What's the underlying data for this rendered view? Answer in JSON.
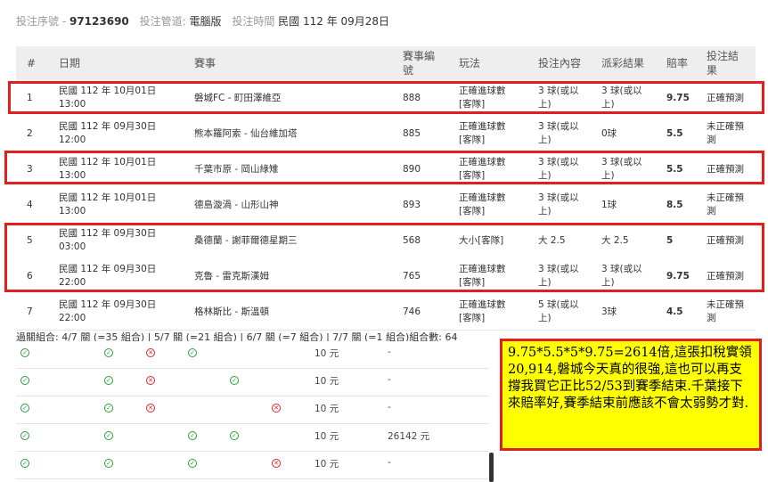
{
  "header": {
    "serial_label": "投注序號 -",
    "serial_value": "97123690",
    "channel_label": "投注管道:",
    "channel_value": "電腦版",
    "time_label": "投注時間",
    "time_value": "民國 112 年 09月28日"
  },
  "table": {
    "columns": {
      "num": "#",
      "date": "日期",
      "match": "賽事",
      "code": "賽事編號",
      "play": "玩法",
      "bet": "投注內容",
      "result": "派彩結果",
      "odds": "賠率",
      "outcome": "投注結果"
    },
    "rows": [
      {
        "num": "1",
        "date": "民國 112 年 10月01日 13:00",
        "match": "磐城FC - 町田澤維亞",
        "code": "888",
        "play": "正確進球數 [客隊]",
        "bet": "3 球(或以上)",
        "result": "3 球(或以上)",
        "odds": "9.75",
        "outcome": "正確預測"
      },
      {
        "num": "2",
        "date": "民國 112 年 09月30日 12:00",
        "match": "熊本羅阿索 - 仙台維加塔",
        "code": "885",
        "play": "正確進球數 [客隊]",
        "bet": "3 球(或以上)",
        "result": "0球",
        "odds": "5.5",
        "outcome": "未正確預測"
      },
      {
        "num": "3",
        "date": "民國 112 年 10月01日 13:00",
        "match": "千葉市原 - 岡山綠雉",
        "code": "890",
        "play": "正確進球數 [客隊]",
        "bet": "3 球(或以上)",
        "result": "3 球(或以上)",
        "odds": "5.5",
        "outcome": "正確預測"
      },
      {
        "num": "4",
        "date": "民國 112 年 10月01日 13:00",
        "match": "德島漩渦 - 山形山神",
        "code": "893",
        "play": "正確進球數 [客隊]",
        "bet": "3 球(或以上)",
        "result": "1球",
        "odds": "8.5",
        "outcome": "未正確預測"
      },
      {
        "num": "5",
        "date": "民國 112 年 09月30日 03:00",
        "match": "桑德蘭 - 謝菲爾德星期三",
        "code": "568",
        "play": "大小[客隊]",
        "bet": "大 2.5",
        "result": "大 2.5",
        "odds": "5",
        "outcome": "正確預測"
      },
      {
        "num": "6",
        "date": "民國 112 年 09月30日 22:00",
        "match": "克魯 - 雷克斯漢姆",
        "code": "765",
        "play": "正確進球數 [客隊]",
        "bet": "3 球(或以上)",
        "result": "3 球(或以上)",
        "odds": "9.75",
        "outcome": "正確預測"
      },
      {
        "num": "7",
        "date": "民國 112 年 09月30日 22:00",
        "match": "格林斯比 - 斯溫頓",
        "code": "746",
        "play": "正確進球數 [客隊]",
        "bet": "5 球(或以上)",
        "result": "3球",
        "odds": "4.5",
        "outcome": "未正確預測"
      }
    ]
  },
  "parlay_text": "過關組合: 4/7 關 (=35 組合) | 5/7 關 (=21 組合) | 6/7 關 (=7 組合) | 7/7 關 (=1 組合)組合數: 64",
  "combos": [
    {
      "amount": "10 元",
      "win": "-"
    },
    {
      "amount": "10 元",
      "win": "-"
    },
    {
      "amount": "10 元",
      "win": "-"
    },
    {
      "amount": "10 元",
      "win": "26142 元"
    },
    {
      "amount": "10 元",
      "win": "-"
    }
  ],
  "annotation": "9.75*5.5*5*9.75=2614倍,這張扣稅實領20,914,磐城今天真的很強,這也可以再支撐我買它正比52/53到賽季結束.千葉接下來賠率好,賽季結束前應該不會太弱勢才對.",
  "colors": {
    "highlight_border": "#e02020",
    "note_bg": "#ffff00",
    "ok": "#2a9d3a",
    "fail": "#d62b2b"
  }
}
